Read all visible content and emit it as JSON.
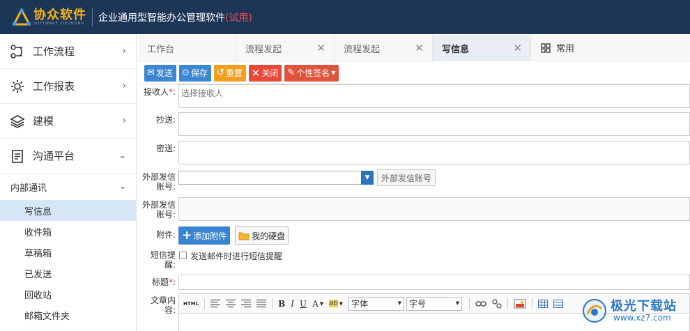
{
  "header": {
    "logo_text": "协众软件",
    "logo_sub": "SOFTWARE XIEZHONG",
    "app_title": "企业通用型智能办公管理软件",
    "trial_label": "(试用)"
  },
  "sidebar": {
    "items": [
      {
        "label": "工作流程",
        "icon": "workflow-icon",
        "arrow": "›"
      },
      {
        "label": "工作报表",
        "icon": "gear-icon",
        "arrow": "›"
      },
      {
        "label": "建模",
        "icon": "layers-icon",
        "arrow": "›"
      },
      {
        "label": "沟通平台",
        "icon": "document-icon",
        "arrow": "⌄"
      }
    ],
    "sub_header": {
      "label": "内部通讯",
      "arrow": "⌄"
    },
    "sub_items": [
      {
        "label": "写信息",
        "active": true
      },
      {
        "label": "收件箱"
      },
      {
        "label": "草稿箱"
      },
      {
        "label": "已发送"
      },
      {
        "label": "回收站"
      },
      {
        "label": "邮箱文件夹"
      }
    ]
  },
  "tabs": [
    {
      "label": "工作台",
      "closable": false
    },
    {
      "label": "流程发起",
      "closable": true
    },
    {
      "label": "流程发起",
      "closable": true
    },
    {
      "label": "写信息",
      "closable": true,
      "active": true
    }
  ],
  "tab_common": {
    "label": "常用",
    "icon": "grid-icon"
  },
  "toolbar": {
    "send": "发送",
    "save": "保存",
    "reset": "重置",
    "close": "关闭",
    "signature": "个性签名"
  },
  "form": {
    "recipient_label": "接收人",
    "recipient_required": "*",
    "recipient_colon": ":",
    "recipient_placeholder": "选择接收人",
    "cc_label": "抄送:",
    "bcc_label": "密送:",
    "ext_account_label_1": "外部发信",
    "ext_account_label_2": "账号:",
    "ext_account_button": "外部发信账号",
    "ext_account2_label_1": "外部发信",
    "ext_account2_label_2": "账号:",
    "attach_label": "附件:",
    "add_attach": "添加附件",
    "my_disk": "我的硬盘",
    "sms_label_1": "短信提",
    "sms_label_2": "醒:",
    "sms_text": "发送邮件时进行短信提醒",
    "title_label": "标题",
    "title_required": "*",
    "title_colon": ":",
    "content_label_1": "文章内",
    "content_label_2": "容:",
    "editor": {
      "html": "HTML",
      "bold": "B",
      "italic": "I",
      "underline": "U",
      "font_color": "A",
      "highlight": "ab",
      "font_family": "字体",
      "font_size": "字号"
    }
  },
  "watermark": {
    "text": "极光下载站",
    "url": "www.xz7.com"
  },
  "colors": {
    "header_bg": "#1c3658",
    "accent_blue": "#3d86d0",
    "orange": "#f0a020",
    "red": "#e9493a",
    "active_sidebar": "#d6e6f6"
  }
}
